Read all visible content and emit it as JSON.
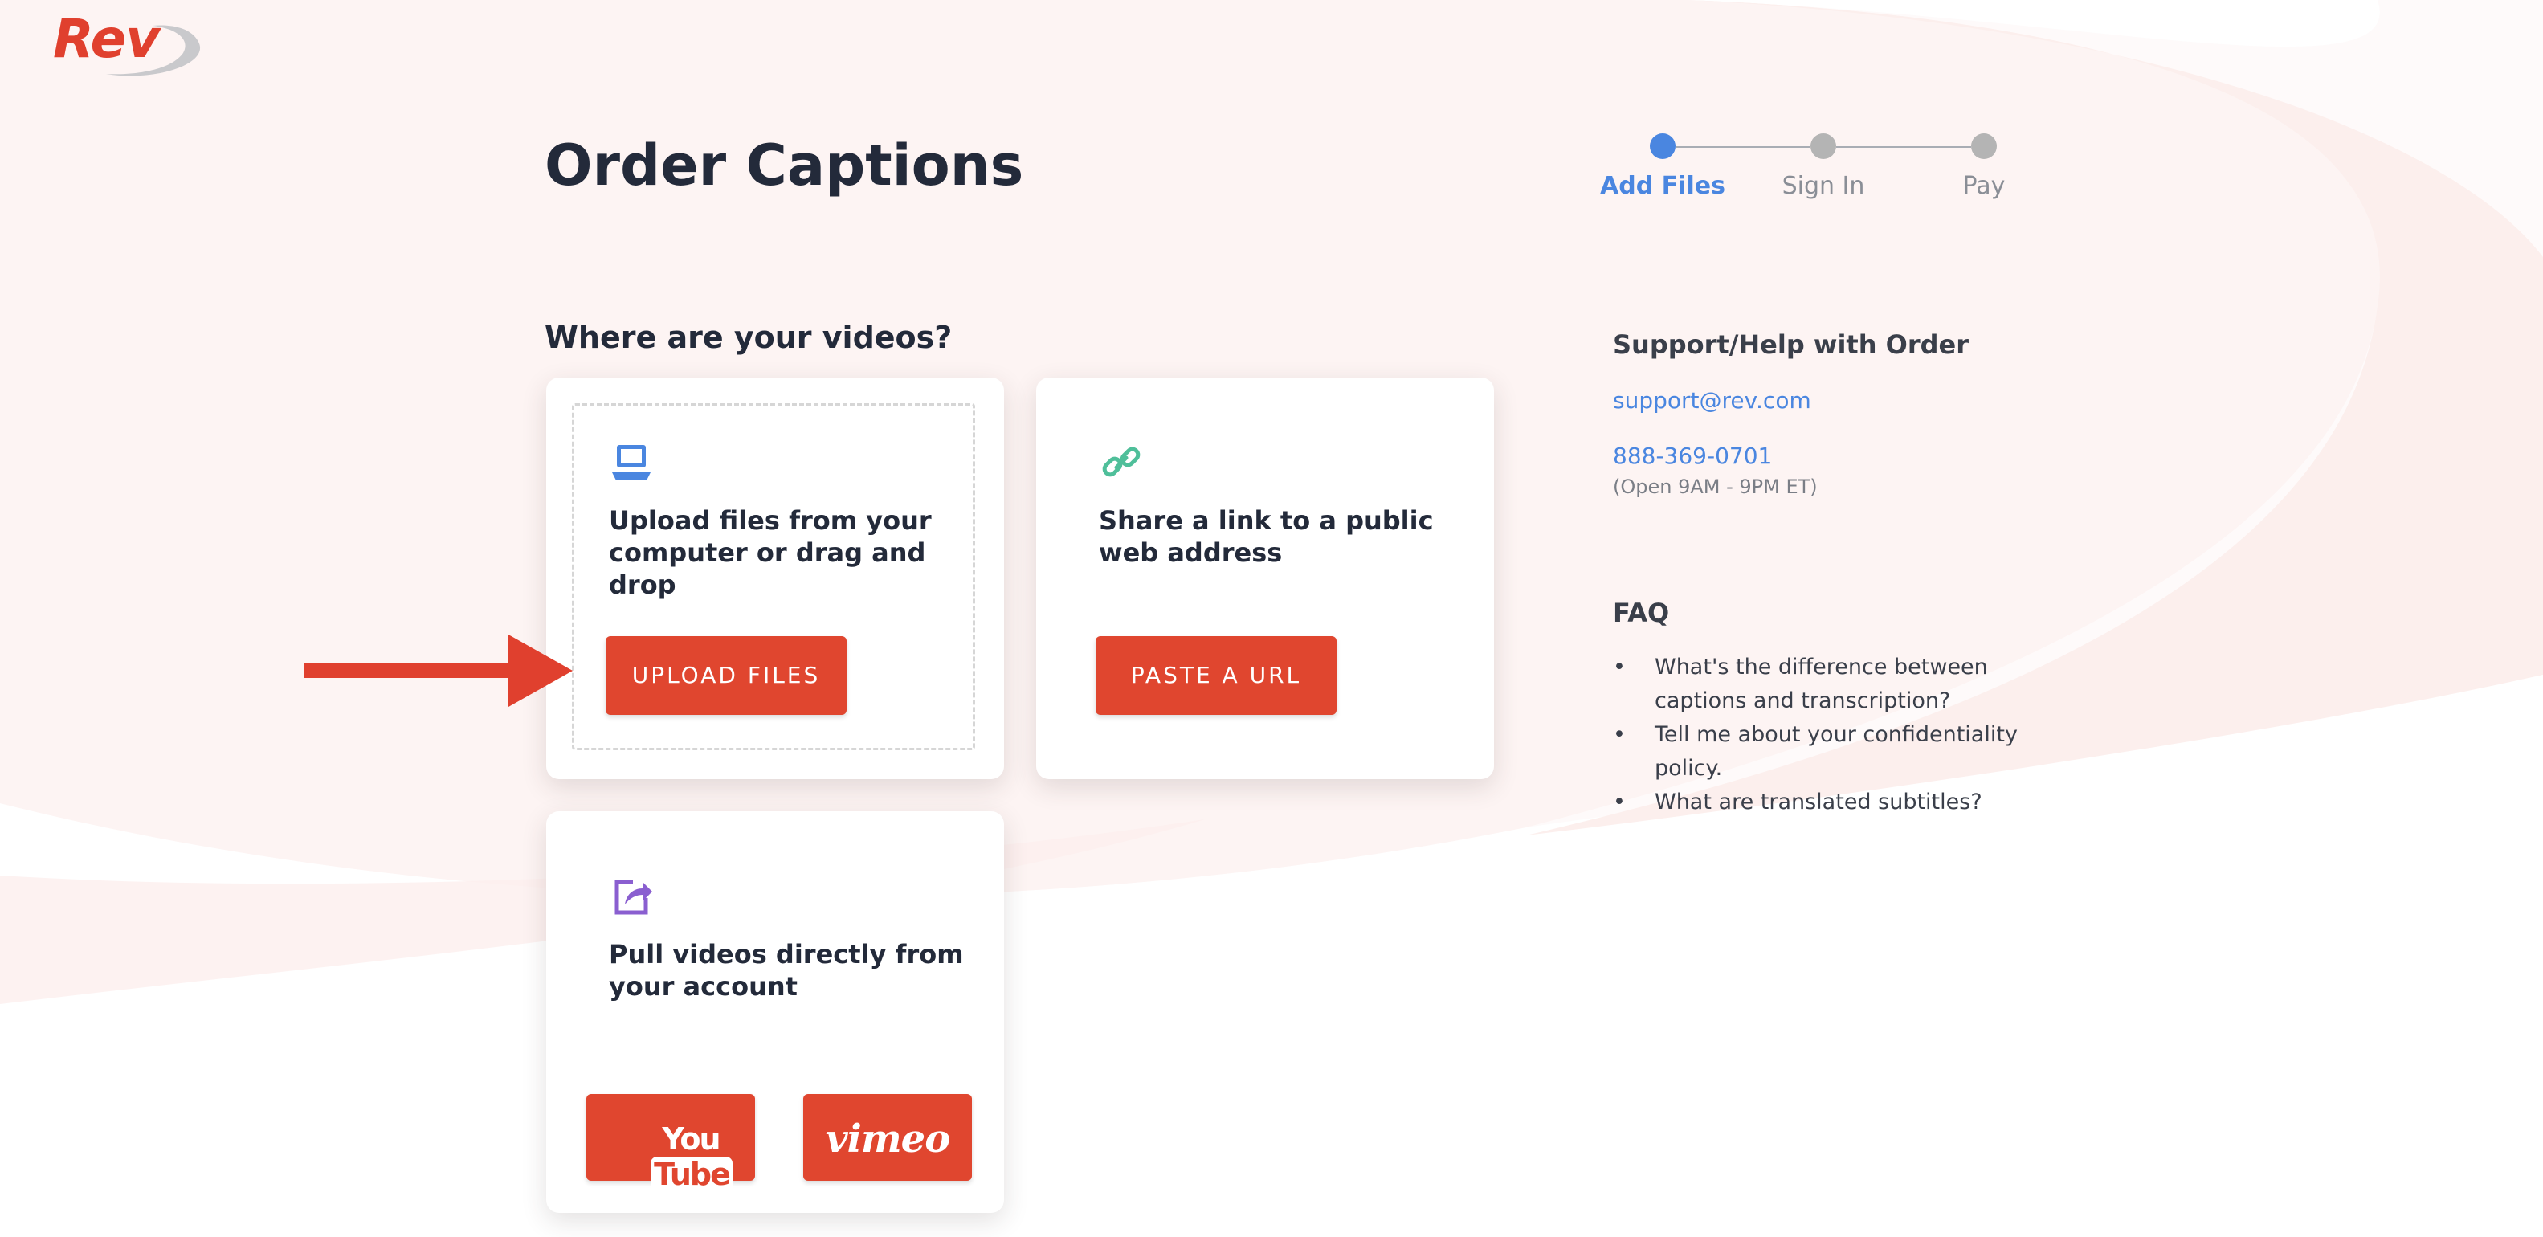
{
  "brand": {
    "logo_text": "Rev",
    "primary_color": "#e0462f",
    "link_color": "#4a86e0"
  },
  "page": {
    "title": "Order Captions"
  },
  "stepper": {
    "steps": [
      {
        "label": "Add Files",
        "active": true
      },
      {
        "label": "Sign In",
        "active": false
      },
      {
        "label": "Pay",
        "active": false
      }
    ]
  },
  "main": {
    "section_title": "Where are your videos?",
    "cards": {
      "upload": {
        "icon": "laptop-icon",
        "text": "Upload files from your computer or drag and drop",
        "button_label": "UPLOAD FILES"
      },
      "url": {
        "icon": "link-icon",
        "text": "Share a link to a public web address",
        "button_label": "PASTE A URL"
      },
      "account": {
        "icon": "share-icon",
        "text": "Pull videos directly from your account",
        "youtube_label_1": "You",
        "youtube_label_2": "Tube",
        "vimeo_label": "vimeo"
      }
    }
  },
  "support": {
    "heading": "Support/Help with Order",
    "email": "support@rev.com",
    "phone": "888-369-0701",
    "hours": "(Open 9AM - 9PM ET)"
  },
  "faq": {
    "heading": "FAQ",
    "bullet": "•",
    "items": [
      "What's the difference between captions and transcription?",
      "Tell me about your confidentiality policy.",
      "What are translated subtitles?"
    ]
  }
}
